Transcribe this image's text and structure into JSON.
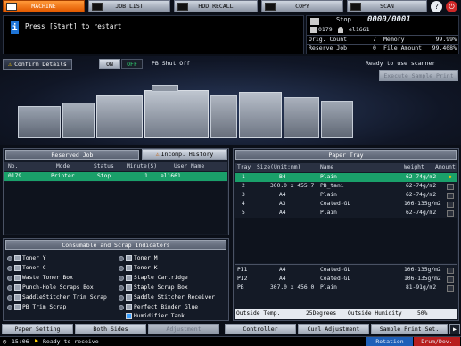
{
  "tabs": [
    {
      "label": "MACHINE",
      "icon": "machine-icon",
      "active": true
    },
    {
      "label": "JOB LIST",
      "icon": "job-list-icon",
      "active": false
    },
    {
      "label": "HDD RECALL",
      "icon": "hdd-recall-icon",
      "active": false
    },
    {
      "label": "COPY",
      "icon": "copy-icon",
      "active": false
    },
    {
      "label": "SCAN",
      "icon": "scan-icon",
      "active": false
    }
  ],
  "message": "Press [Start] to restart",
  "status": {
    "state": "Stop",
    "counter": "0000/0001",
    "job_no": "0179",
    "user": "el1661",
    "orig_count_label": "Orig. Count",
    "orig_count_value": "7",
    "memory_label": "Memory",
    "memory_value": "99.99%",
    "reserve_job_label": "Reserve Job",
    "reserve_job_value": "0",
    "file_amount_label": "File Amount",
    "file_amount_value": "99.408%"
  },
  "machine_bar": {
    "confirm_details": "Confirm Details",
    "on_label": "ON",
    "off_label": "OFF",
    "pb_shut_off": "PB Shut Off",
    "scanner_status": "Ready to use scanner",
    "execute_sample_print": "Execute Sample Print"
  },
  "reserved_job": {
    "title": "Reserved Job",
    "incomp_history": "Incomp. History",
    "columns": [
      "No.",
      "Mode",
      "Status",
      "Minute(S)",
      "User Name"
    ],
    "rows": [
      {
        "no": "0179",
        "mode": "Printer",
        "status": "Stop",
        "minutes": "1",
        "user": "el1661"
      }
    ]
  },
  "consumables": {
    "title": "Consumable and Scrap Indicators",
    "left": [
      {
        "label": "Toner Y",
        "icon": "toner-icon"
      },
      {
        "label": "Toner C",
        "icon": "toner-icon"
      },
      {
        "label": "Waste Toner Box",
        "icon": "waste-toner-icon"
      },
      {
        "label": "Punch-Hole Scraps Box",
        "icon": "punch-scraps-icon"
      },
      {
        "label": "SaddleStitcher Trim Scrap",
        "icon": "trim-scrap-icon"
      },
      {
        "label": "PB Trim Scrap",
        "icon": "trim-scrap-icon"
      }
    ],
    "right": [
      {
        "label": "Toner M",
        "icon": "toner-icon"
      },
      {
        "label": "Toner K",
        "icon": "toner-icon"
      },
      {
        "label": "Staple Cartridge",
        "icon": "staple-icon"
      },
      {
        "label": "Staple Scrap Box",
        "icon": "staple-icon"
      },
      {
        "label": "Saddle Stitcher Receiver",
        "icon": "staple-icon"
      },
      {
        "label": "Perfect Binder Glue",
        "icon": "glue-icon"
      },
      {
        "label": "Humidifier Tank",
        "icon": "humidifier-icon"
      }
    ]
  },
  "paper_tray": {
    "title": "Paper Tray",
    "columns": [
      "Tray",
      "Size(Unit:mm)",
      "Name",
      "Weight",
      "Amount"
    ],
    "rows": [
      {
        "tray": "1",
        "size": "B4",
        "name": "Plain",
        "weight": "62-74g/m2"
      },
      {
        "tray": "2",
        "size": "300.0 x 455.7",
        "name": "PB_tani",
        "weight": "62-74g/m2"
      },
      {
        "tray": "3",
        "size": "A4",
        "name": "Plain",
        "weight": "62-74g/m2"
      },
      {
        "tray": "4",
        "size": "A3",
        "name": "Coated-GL",
        "weight": "106-135g/m2"
      },
      {
        "tray": "5",
        "size": "A4",
        "name": "Plain",
        "weight": "62-74g/m2"
      }
    ],
    "bottom_rows": [
      {
        "tray": "PI1",
        "size": "A4",
        "name": "Coated-GL",
        "weight": "106-135g/m2"
      },
      {
        "tray": "PI2",
        "size": "A4",
        "name": "Coated-GL",
        "weight": "106-135g/m2"
      },
      {
        "tray": "PB",
        "size": "307.0 x 456.0",
        "name": "Plain",
        "weight": "81-91g/m2"
      }
    ],
    "outside_temp_label": "Outside Temp.",
    "outside_temp_value": "25Degrees",
    "outside_humidity_label": "Outside Humidity",
    "outside_humidity_value": "50%"
  },
  "bottom_buttons": [
    "Paper Setting",
    "Both Sides",
    "Adjustment",
    "Controller",
    "Curl Adjustment",
    "Sample Print Set."
  ],
  "footer": {
    "time": "15:06",
    "status": "Ready to receive",
    "rotation": "Rotation",
    "drum_dev": "Drum/Dev."
  },
  "colors": {
    "accent": "#ff7a00",
    "selected_row": "#1aa06a",
    "panel": "#141a26"
  }
}
